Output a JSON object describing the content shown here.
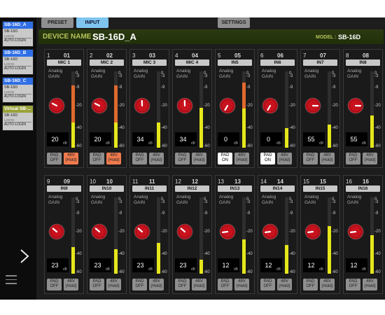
{
  "sidebar": {
    "devices": [
      {
        "name": "SB-16D_A",
        "model": "SB-16D",
        "login": "LOGIN",
        "auto": "AUTO-LOGIN",
        "color": "#2f6ee6"
      },
      {
        "name": "SB-16D_B",
        "model": "SB-16D",
        "login": "LOGIN",
        "auto": "AUTO-LOGIN",
        "color": "#2f6ee6"
      },
      {
        "name": "SB-16D_C",
        "model": "SB-16D",
        "login": "LOGIN",
        "auto": "AUTO-LOGIN",
        "color": "#2f6ee6"
      },
      {
        "name": "Virtual SB-...",
        "model": "SB-16D",
        "login": "LOGIN",
        "auto": "AUTO-LOGIN",
        "color": "#9aa23a"
      }
    ]
  },
  "tabs": {
    "preset": "PRESET",
    "input": "INPUT",
    "settings": "SETTINGS",
    "active": "INPUT"
  },
  "device": {
    "name_label": "DEVICE NAME :",
    "name": "SB-16D_A",
    "model_label": "MODEL :",
    "model": "SB-16D"
  },
  "strings": {
    "gain1": "Analog",
    "gain2": "GAIN",
    "unit": "dB",
    "pad": "PAD",
    "v48": "48V",
    "hold": "(Hold)"
  },
  "scale": [
    "0",
    "-3",
    "-9",
    "-20",
    "-40",
    "-60"
  ],
  "colors": {
    "accent": "#7ec4ee",
    "meter_yellow": "#e6e61c",
    "meter_orange": "#e0692e",
    "knob_red": "#c8121e"
  },
  "channels": [
    {
      "num": "1",
      "num2": "01",
      "name": "MIC 1",
      "gain": 20,
      "pad": "OFF",
      "phantom": "on",
      "meter": 0.82,
      "meter_top": 0.6
    },
    {
      "num": "2",
      "num2": "02",
      "name": "MIC 2",
      "gain": 20,
      "pad": "OFF",
      "phantom": "on",
      "meter": 0.82,
      "meter_top": 0.6
    },
    {
      "num": "3",
      "num2": "03",
      "name": "MIC 3",
      "gain": 34,
      "pad": "OFF",
      "phantom": "off",
      "meter": 0.33,
      "meter_top": 0
    },
    {
      "num": "4",
      "num2": "04",
      "name": "MIC 4",
      "gain": 34,
      "pad": "OFF",
      "phantom": "off",
      "meter": 0.52,
      "meter_top": 0
    },
    {
      "num": "5",
      "num2": "05",
      "name": "IN5",
      "gain": 0,
      "pad": "ON",
      "phantom": "off",
      "meter": 0.85,
      "meter_top": 0.4
    },
    {
      "num": "6",
      "num2": "06",
      "name": "IN6",
      "gain": 0,
      "pad": "ON",
      "phantom": "off",
      "meter": 0.26,
      "meter_top": 0
    },
    {
      "num": "7",
      "num2": "07",
      "name": "IN7",
      "gain": 55,
      "pad": "OFF",
      "phantom": "off",
      "meter": 0.3,
      "meter_top": 0
    },
    {
      "num": "8",
      "num2": "08",
      "name": "IN8",
      "gain": 55,
      "pad": "OFF",
      "phantom": "off",
      "meter": 0.42,
      "meter_top": 0
    },
    {
      "num": "9",
      "num2": "09",
      "name": "IN9",
      "gain": 23,
      "pad": "OFF",
      "phantom": "off",
      "meter": 0.35,
      "meter_top": 0
    },
    {
      "num": "10",
      "num2": "10",
      "name": "IN10",
      "gain": 23,
      "pad": "OFF",
      "phantom": "off",
      "meter": 0.32,
      "meter_top": 0
    },
    {
      "num": "11",
      "num2": "11",
      "name": "IN11",
      "gain": 23,
      "pad": "OFF",
      "phantom": "off",
      "meter": 0.4,
      "meter_top": 0
    },
    {
      "num": "12",
      "num2": "12",
      "name": "IN12",
      "gain": 23,
      "pad": "OFF",
      "phantom": "off",
      "meter": 0.18,
      "meter_top": 0
    },
    {
      "num": "13",
      "num2": "13",
      "name": "IN13",
      "gain": 12,
      "pad": "OFF",
      "phantom": "off",
      "meter": 0.45,
      "meter_top": 0
    },
    {
      "num": "14",
      "num2": "14",
      "name": "IN14",
      "gain": 12,
      "pad": "OFF",
      "phantom": "off",
      "meter": 0.38,
      "meter_top": 0
    },
    {
      "num": "15",
      "num2": "15",
      "name": "IN15",
      "gain": 12,
      "pad": "OFF",
      "phantom": "off",
      "meter": 0.62,
      "meter_top": 0
    },
    {
      "num": "16",
      "num2": "16",
      "name": "IN16",
      "gain": 12,
      "pad": "OFF",
      "phantom": "off",
      "meter": 0.5,
      "meter_top": 0
    }
  ]
}
